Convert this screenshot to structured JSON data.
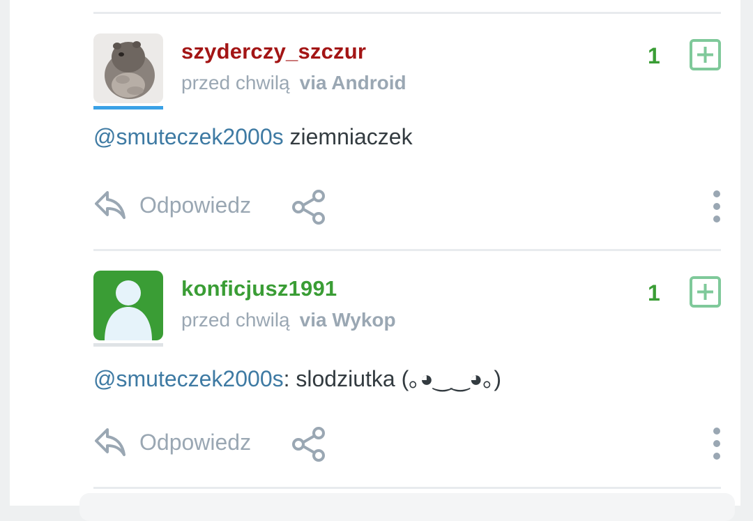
{
  "colors": {
    "username_red": "#a31515",
    "username_green": "#3a9d35",
    "mention_blue": "#3e7aa3",
    "muted_gray": "#9aa7b3",
    "vote_green": "#3a9d35",
    "plus_border": "#7fc99a",
    "avatar_underline_blue": "#3aa1e6",
    "avatar_underline_gray": "#dfe3e6"
  },
  "comments": [
    {
      "username": "szyderczy_szczur",
      "time": "przed chwilą",
      "via": "via Android",
      "votes": "1",
      "mention": "@smuteczek2000s",
      "text": " ziemniaczek",
      "reply_label": "Odpowiedz",
      "avatar": "hamster-photo"
    },
    {
      "username": "konficjusz1991",
      "time": "przed chwilą",
      "via": "via Wykop",
      "votes": "1",
      "mention": "@smuteczek2000s",
      "text": ": slodziutka (｡◕‿‿◕｡)",
      "reply_label": "Odpowiedz",
      "avatar": "default-user-avatar"
    }
  ]
}
